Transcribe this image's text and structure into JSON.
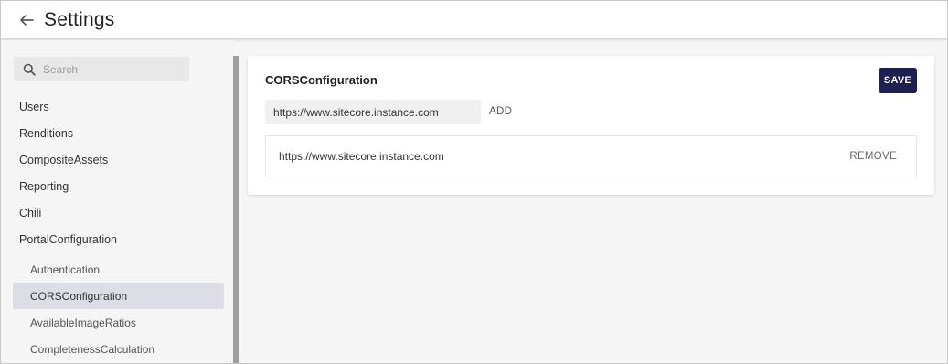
{
  "header": {
    "back_icon": "arrow-left-icon",
    "title": "Settings"
  },
  "sidebar": {
    "search": {
      "placeholder": "Search",
      "value": "",
      "icon": "search-icon"
    },
    "items": [
      {
        "label": "Users"
      },
      {
        "label": "Renditions"
      },
      {
        "label": "CompositeAssets"
      },
      {
        "label": "Reporting"
      },
      {
        "label": "Chili"
      },
      {
        "label": "PortalConfiguration"
      }
    ],
    "subitems": [
      {
        "label": "Authentication",
        "active": false
      },
      {
        "label": "CORSConfiguration",
        "active": true
      },
      {
        "label": "AvailableImageRatios",
        "active": false
      },
      {
        "label": "CompletenessCalculation",
        "active": false
      }
    ]
  },
  "main": {
    "title": "CORSConfiguration",
    "save_label": "SAVE",
    "input_value": "https://www.sitecore.instance.com",
    "add_label": "ADD",
    "origins": [
      {
        "url": "https://www.sitecore.instance.com",
        "remove_label": "REMOVE"
      }
    ]
  },
  "colors": {
    "accent": "#1f2052",
    "active_nav_bg": "#dddee5",
    "page_bg": "#f5f5f5"
  }
}
